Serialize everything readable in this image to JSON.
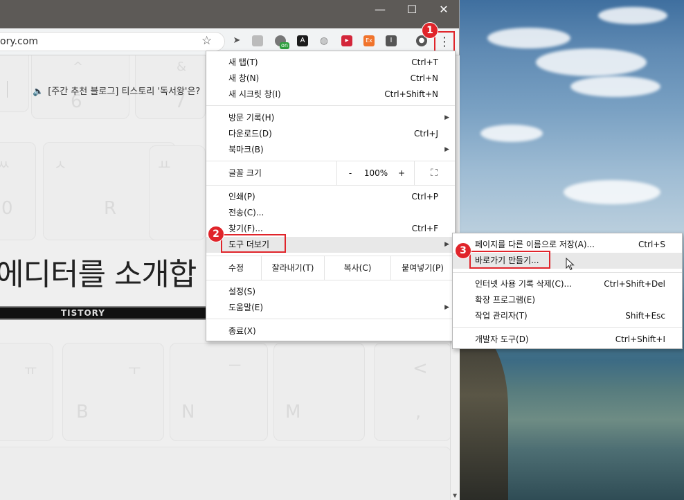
{
  "window_controls": {
    "minimize": "—",
    "maximize": "☐",
    "close": "✕"
  },
  "address_bar": {
    "url": "ory.com"
  },
  "extensions": {
    "on_badge": "on"
  },
  "page": {
    "notice": "[주간 추천 블로그] 티스토리 '독서왕'은?",
    "headline": "에디터를 소개합",
    "banner": "TISTORY",
    "keys": [
      "^",
      "&",
      "6",
      "7",
      "ㅆ",
      "ㅅ",
      "ㅛ",
      "0",
      "R",
      "ㅠ",
      "ㅜ",
      "ㅡ",
      "B",
      "N",
      "M",
      "<",
      ","
    ]
  },
  "main_menu": {
    "items": [
      {
        "label": "새 탭(T)",
        "shortcut": "Ctrl+T"
      },
      {
        "label": "새 창(N)",
        "shortcut": "Ctrl+N"
      },
      {
        "label": "새 시크릿 창(I)",
        "shortcut": "Ctrl+Shift+N"
      },
      {
        "label": "방문 기록(H)",
        "shortcut": ""
      },
      {
        "label": "다운로드(D)",
        "shortcut": "Ctrl+J"
      },
      {
        "label": "북마크(B)",
        "shortcut": ""
      },
      {
        "label": "인쇄(P)",
        "shortcut": "Ctrl+P"
      },
      {
        "label": "전송(C)...",
        "shortcut": ""
      },
      {
        "label": "찾기(F)...",
        "shortcut": "Ctrl+F"
      },
      {
        "label": "도구 더보기",
        "shortcut": ""
      },
      {
        "label": "설정(S)",
        "shortcut": ""
      },
      {
        "label": "도움말(E)",
        "shortcut": ""
      },
      {
        "label": "종료(X)",
        "shortcut": ""
      }
    ],
    "zoom": {
      "label": "글꼴 크기",
      "minus": "-",
      "value": "100%",
      "plus": "+"
    },
    "edit": {
      "label": "수정",
      "cut": "잘라내기(T)",
      "copy": "복사(C)",
      "paste": "붙여넣기(P)"
    }
  },
  "submenu": {
    "items": [
      {
        "label": "페이지를 다른 이름으로 저장(A)...",
        "shortcut": "Ctrl+S"
      },
      {
        "label": "바로가기 만들기...",
        "shortcut": ""
      },
      {
        "label": "인터넷 사용 기록 삭제(C)...",
        "shortcut": "Ctrl+Shift+Del"
      },
      {
        "label": "확장 프로그램(E)",
        "shortcut": ""
      },
      {
        "label": "작업 관리자(T)",
        "shortcut": "Shift+Esc"
      },
      {
        "label": "개발자 도구(D)",
        "shortcut": "Ctrl+Shift+I"
      }
    ]
  },
  "steps": [
    "1",
    "2",
    "3"
  ],
  "colors": {
    "accent_red": "#e0242a"
  }
}
